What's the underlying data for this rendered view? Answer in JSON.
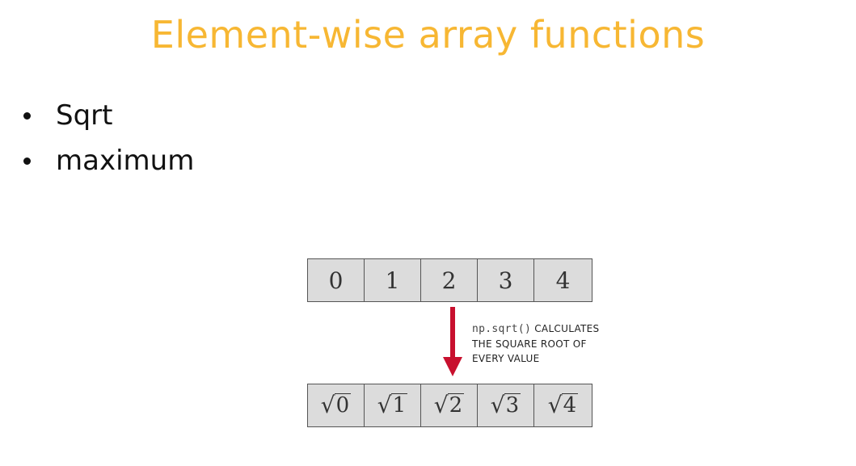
{
  "slide": {
    "title": "Element-wise array functions",
    "bullets": [
      "Sqrt",
      "maximum"
    ]
  },
  "diagram": {
    "input_array": [
      "0",
      "1",
      "2",
      "3",
      "4"
    ],
    "output_symbol": "√",
    "output_array": [
      "0",
      "1",
      "2",
      "3",
      "4"
    ],
    "caption_code": "np.sqrt()",
    "caption_line1_rest": " CALCULATES",
    "caption_line2": "THE SQUARE ROOT OF",
    "caption_line3": "EVERY VALUE",
    "arrow_color": "#c8102e",
    "cell_fill": "#dcdcdc"
  },
  "colors": {
    "title": "#f7b733",
    "text": "#111111"
  }
}
